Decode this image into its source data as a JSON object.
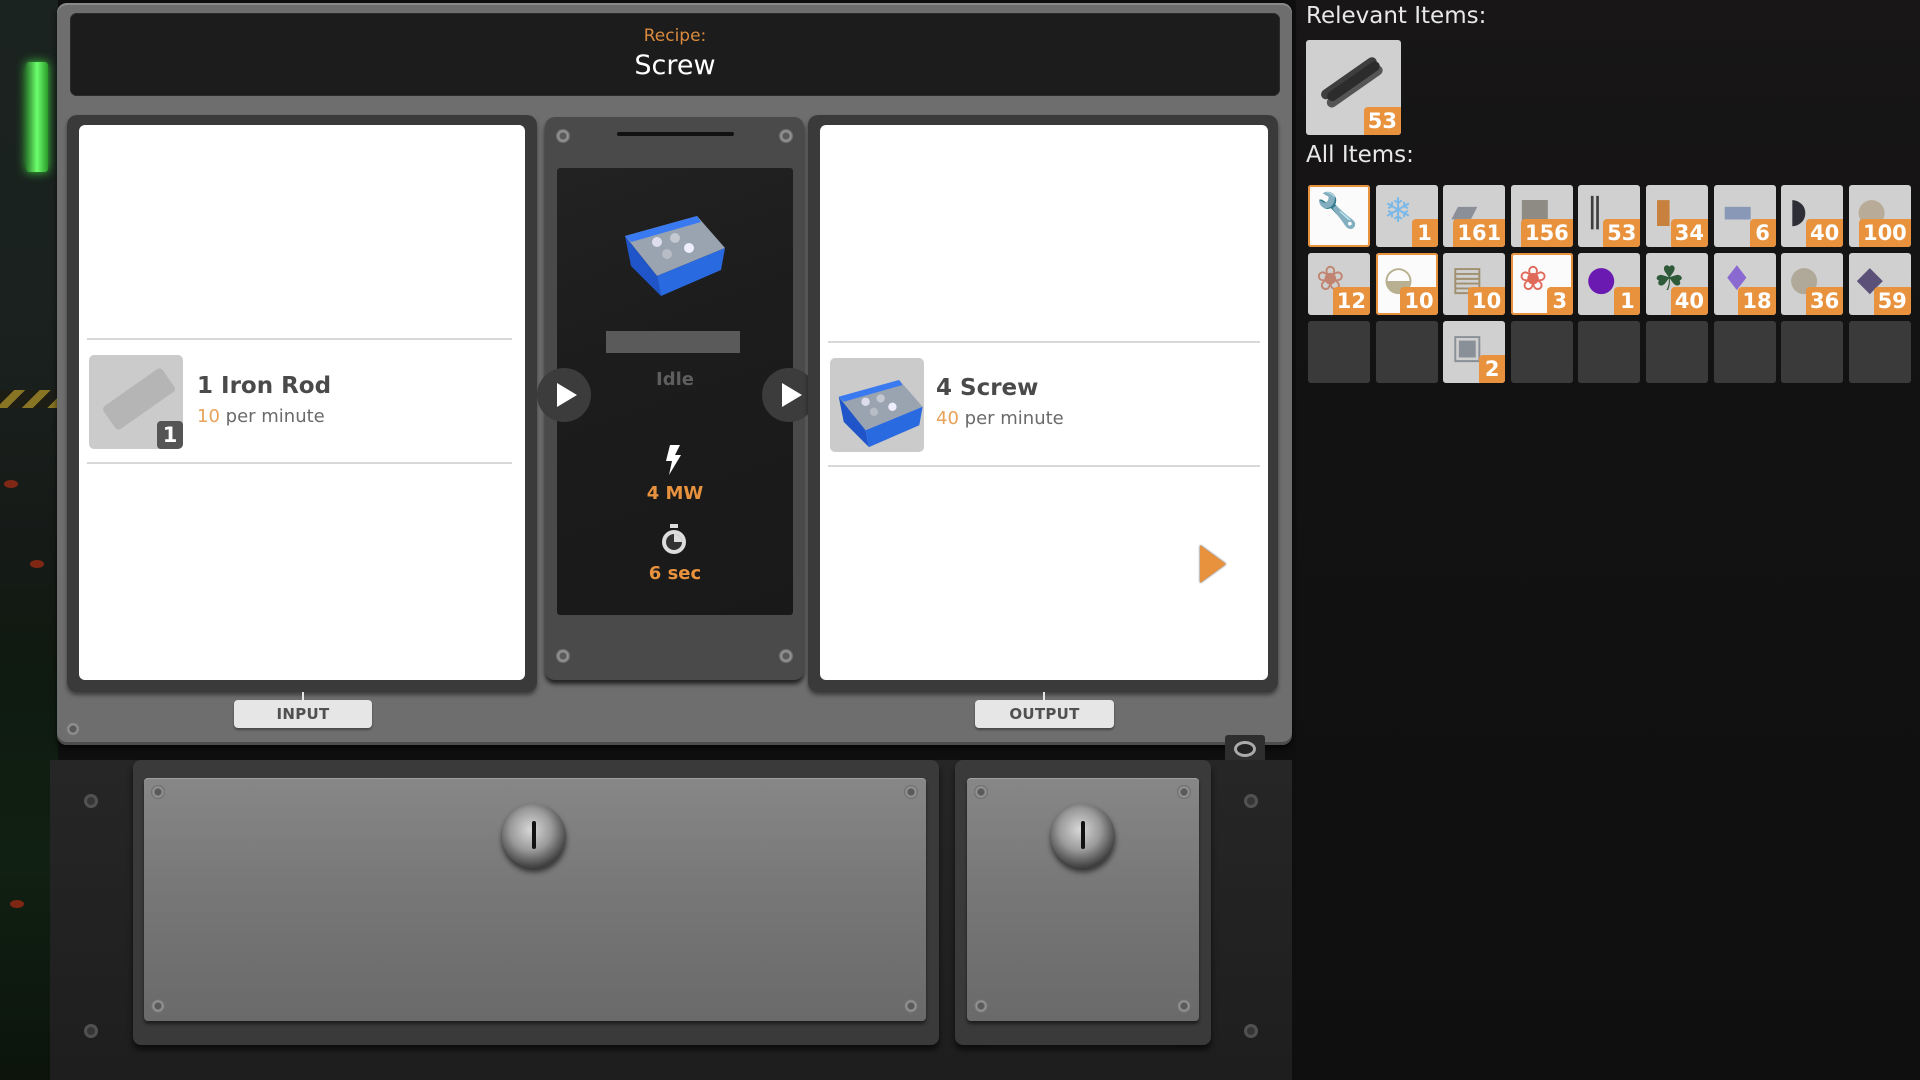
{
  "recipe": {
    "label": "Recipe:",
    "name": "Screw"
  },
  "input": {
    "button_label": "INPUT",
    "items": [
      {
        "name": "1 Iron Rod",
        "rate_value": "10",
        "rate_unit": "per minute",
        "slot_count": "1",
        "icon": "iron-rod-icon"
      }
    ]
  },
  "machine": {
    "product_icon": "screw-bin-icon",
    "status": "Idle",
    "progress": 0,
    "power_icon": "lightning-icon",
    "power": "4 MW",
    "time_icon": "stopwatch-icon",
    "duration": "6 sec"
  },
  "output": {
    "button_label": "OUTPUT",
    "items": [
      {
        "name": "4 Screw",
        "rate_value": "40",
        "rate_unit": "per minute",
        "icon": "screw-bin-icon"
      }
    ]
  },
  "sidebar": {
    "relevant_heading": "Relevant Items:",
    "relevant_items": [
      {
        "icon": "iron-rod-icon",
        "count": "53"
      }
    ],
    "all_heading": "All Items:",
    "all_items": [
      {
        "icon": "tool-icon",
        "count": "",
        "highlight": true
      },
      {
        "icon": "crystal-icon",
        "count": "1"
      },
      {
        "icon": "iron-plate-icon",
        "count": "161"
      },
      {
        "icon": "concrete-icon",
        "count": "156"
      },
      {
        "icon": "iron-rod-icon",
        "count": "53"
      },
      {
        "icon": "wire-spool-icon",
        "count": "34"
      },
      {
        "icon": "plate-icon",
        "count": "6"
      },
      {
        "icon": "cable-icon",
        "count": "40"
      },
      {
        "icon": "limestone-icon",
        "count": "100"
      },
      {
        "icon": "coral-icon",
        "count": "12"
      },
      {
        "icon": "shell-icon",
        "count": "10",
        "highlight": true
      },
      {
        "icon": "bark-icon",
        "count": "10"
      },
      {
        "icon": "berry-icon",
        "count": "3",
        "highlight": true
      },
      {
        "icon": "orb-icon",
        "count": "1"
      },
      {
        "icon": "leaves-icon",
        "count": "40"
      },
      {
        "icon": "amethyst-icon",
        "count": "18"
      },
      {
        "icon": "stone-icon",
        "count": "36"
      },
      {
        "icon": "ore-icon",
        "count": "59"
      },
      {
        "icon": "empty",
        "count": ""
      },
      {
        "icon": "empty",
        "count": ""
      },
      {
        "icon": "ingot-icon",
        "count": "2"
      },
      {
        "icon": "empty",
        "count": ""
      },
      {
        "icon": "empty",
        "count": ""
      },
      {
        "icon": "empty",
        "count": ""
      },
      {
        "icon": "empty",
        "count": ""
      },
      {
        "icon": "empty",
        "count": ""
      },
      {
        "icon": "empty",
        "count": ""
      }
    ]
  },
  "colors": {
    "accent": "#e8923e",
    "recipe_label": "#d98a3d",
    "rate_value": "#e8a25a"
  }
}
